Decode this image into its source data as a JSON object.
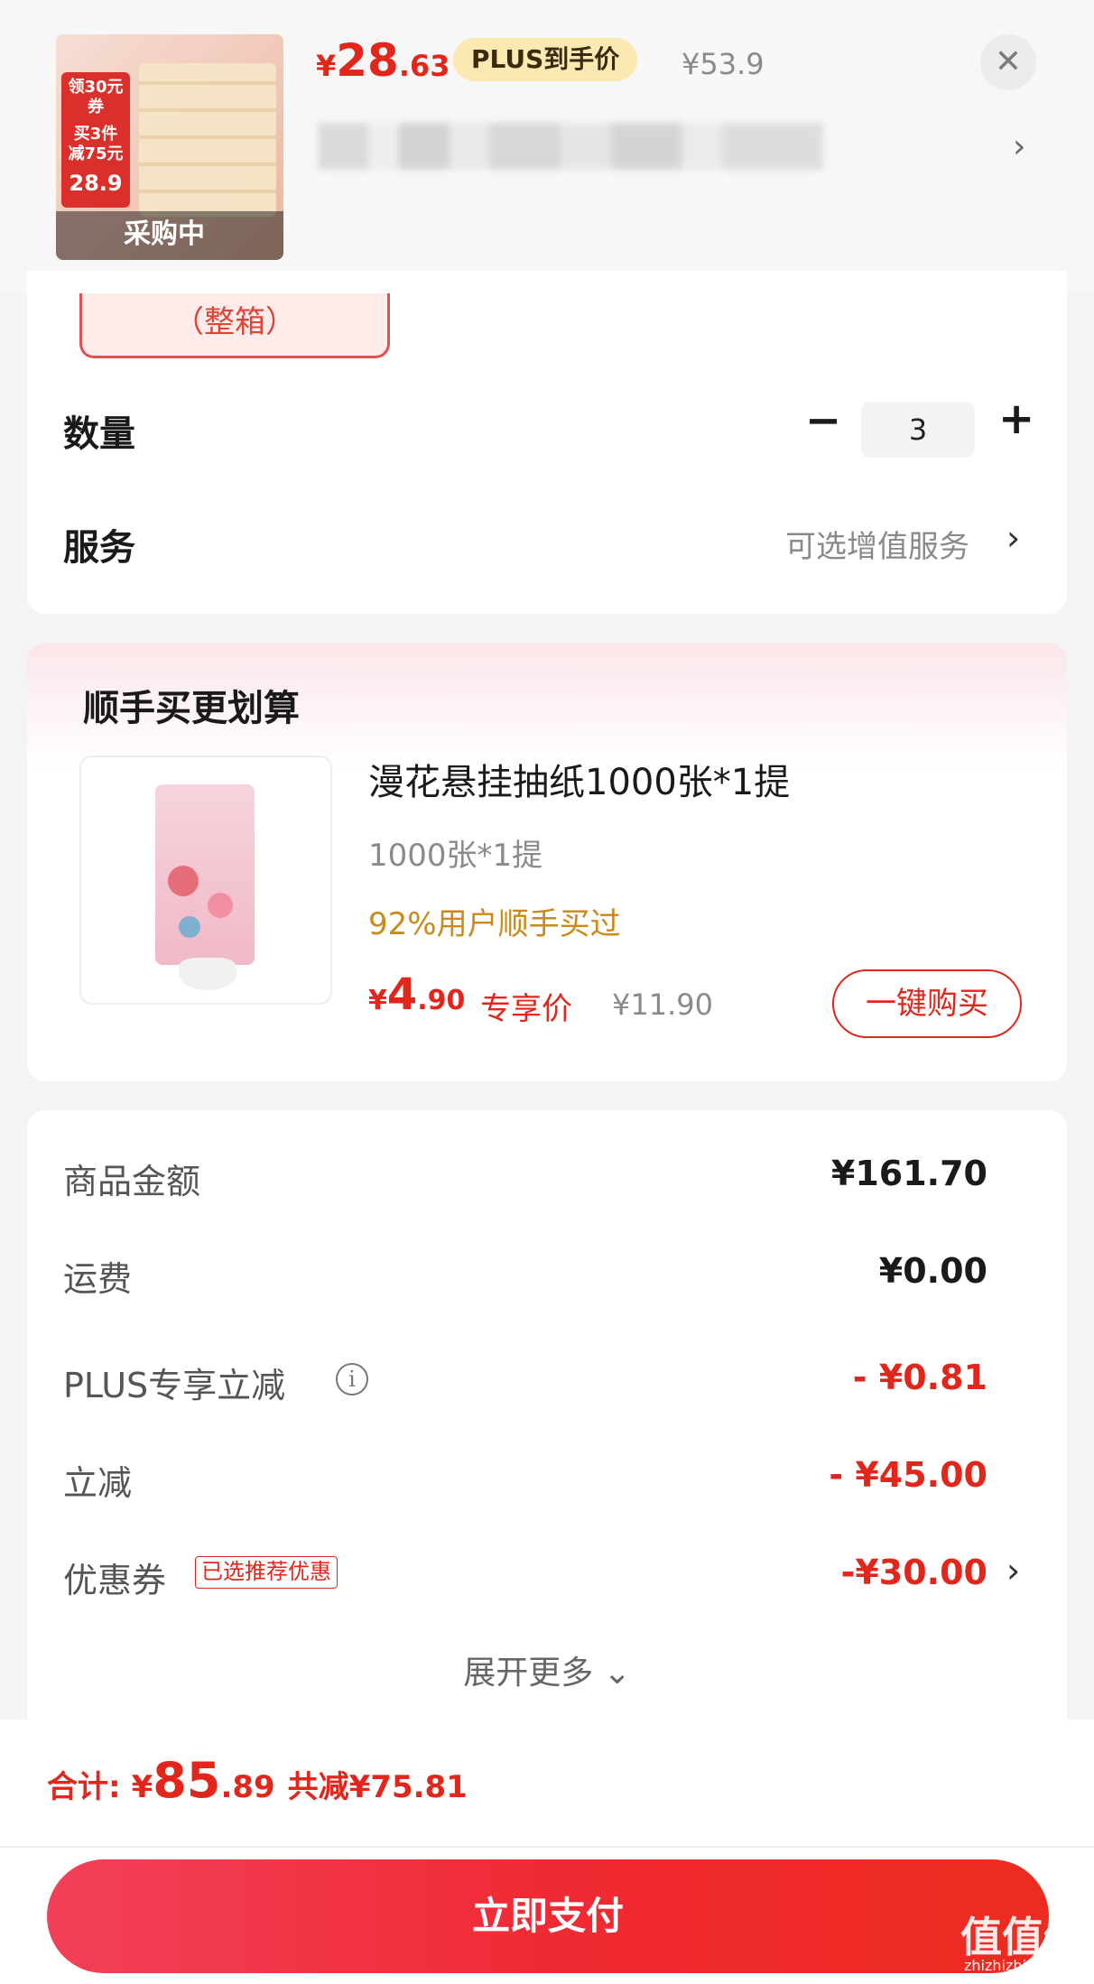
{
  "header": {
    "product_status": "采购中",
    "price_currency": "¥",
    "price_int": "28",
    "price_dec": ".63",
    "plus_tag": "PLUS到手价",
    "original_price": "¥53.9",
    "close_icon": "close-icon",
    "spec_chevron": "›"
  },
  "thumb_promo": {
    "line1": "领30元券",
    "line2": "买3件",
    "line3": "减75元",
    "line4": "28.9"
  },
  "options": {
    "variant_label": "（整箱）",
    "quantity_label": "数量",
    "quantity_value": "3",
    "minus": "−",
    "plus": "+",
    "service_label": "服务",
    "service_value": "可选增值服务",
    "service_chevron": "›"
  },
  "upsell": {
    "title": "顺手买更划算",
    "product_name": "漫花悬挂抽纸1000张*1提",
    "spec": "1000张*1提",
    "social_proof": "92%用户顺手买过",
    "price_currency": "¥",
    "price_int": "4",
    "price_dec": ".90",
    "exclusive_label": "专享价",
    "original_price": "¥11.90",
    "buy_button": "一键购买"
  },
  "summary": {
    "rows": [
      {
        "label": "商品金额",
        "value": "¥161.70",
        "red": false
      },
      {
        "label": "运费",
        "value": "¥0.00",
        "red": false
      },
      {
        "label": "PLUS专享立减",
        "value": "- ¥0.81",
        "red": true
      },
      {
        "label": "立减",
        "value": "- ¥45.00",
        "red": true
      },
      {
        "label": "优惠券",
        "value": "-¥30.00",
        "red": true
      }
    ],
    "coupon_tag": "已选推荐优惠",
    "info_icon": "i",
    "expand_label": "展开更多 ⌄",
    "coupon_chevron": "›"
  },
  "footer": {
    "total_label": "合计:",
    "total_currency": "¥",
    "total_int": "85",
    "total_dec": ".89",
    "total_saved": "共减¥75.81",
    "pay_button": "立即支付"
  },
  "watermark": {
    "logo": "值值值",
    "site": "zhizhizhi.com"
  },
  "colors": {
    "accent_red": "#e3261c",
    "plus_gold": "#fbe9b1",
    "social_orange": "#c98a1a"
  }
}
